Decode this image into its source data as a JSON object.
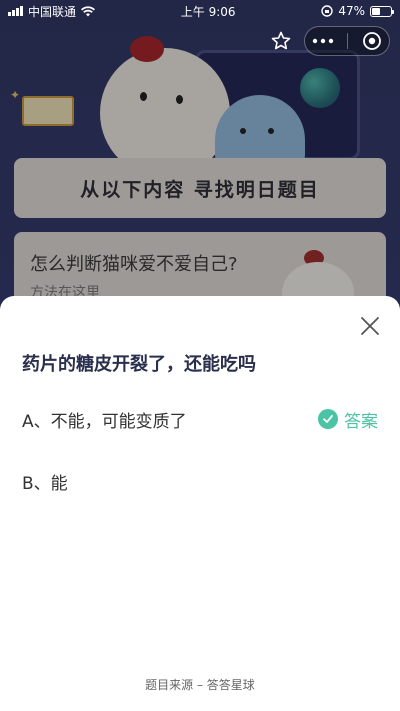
{
  "status_bar": {
    "carrier": "中国联通",
    "time": "上午 9:06",
    "battery": "47%",
    "battery_level": 0.47
  },
  "banner": {
    "title": "从以下内容 寻找明日题目"
  },
  "card": {
    "question": "怎么判断猫咪爱不爱自己?",
    "subtitle": "方法在这里"
  },
  "sheet": {
    "question": "药片的糖皮开裂了，还能吃吗",
    "options": [
      {
        "label": "A、不能，可能变质了",
        "is_answer": true
      },
      {
        "label": "B、能",
        "is_answer": false
      }
    ],
    "answer_label": "答案",
    "source": "题目来源 – 答答星球"
  },
  "colors": {
    "accent": "#4cc3a5",
    "question_text": "#2a2f4d",
    "background": "#303764"
  },
  "icons": {
    "wifi": "wifi-icon",
    "star": "star-icon",
    "more": "more-icon",
    "close_circle": "close-circle-icon",
    "close": "close-icon",
    "check": "check-icon"
  }
}
